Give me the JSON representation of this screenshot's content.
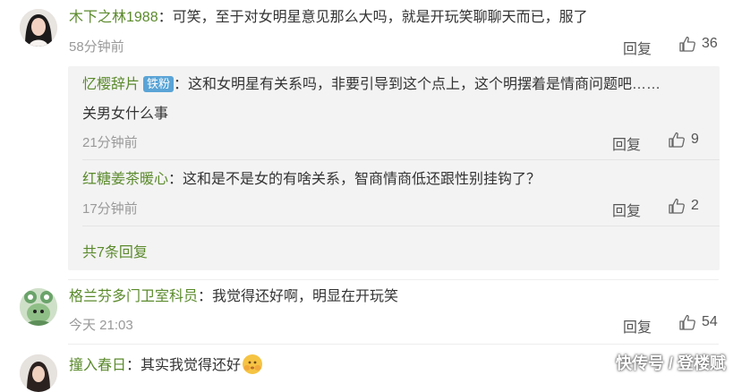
{
  "comments": [
    {
      "username": "木下之林1988",
      "sep": "：",
      "text": "可笑，至于对女明星意见那么大吗，就是开玩笑聊聊天而已，服了",
      "time": "58分钟前",
      "reply_label": "回复",
      "likes": "36",
      "replies": [
        {
          "username": "忆樱辞片",
          "badge": "铁粉",
          "sep": "：",
          "text_line1": "这和女明星有关系吗，非要引导到这个点上，这个明摆着是情商问题吧……",
          "text_line2": "关男女什么事",
          "time": "21分钟前",
          "reply_label": "回复",
          "likes": "9"
        },
        {
          "username": "红糖姜茶暖心",
          "sep": "：",
          "text": "这和是不是女的有啥关系，智商情商低还跟性别挂钩了？",
          "time": "17分钟前",
          "reply_label": "回复",
          "likes": "2"
        }
      ],
      "more_replies": "共7条回复"
    },
    {
      "username": "格兰芬多门卫室科员",
      "sep": "：",
      "text": "我觉得还好啊，明显在开玩笑",
      "time": "今天 21:03",
      "reply_label": "回复",
      "likes": "54"
    },
    {
      "username": "撞入春日",
      "sep": "：",
      "text": "其实我觉得还好"
    }
  ],
  "watermark": "快传号 / 登楼赋",
  "colors": {
    "username": "#5b8a2c",
    "badge": "#5aa4d6",
    "reply_bg": "#f3f3f3"
  }
}
